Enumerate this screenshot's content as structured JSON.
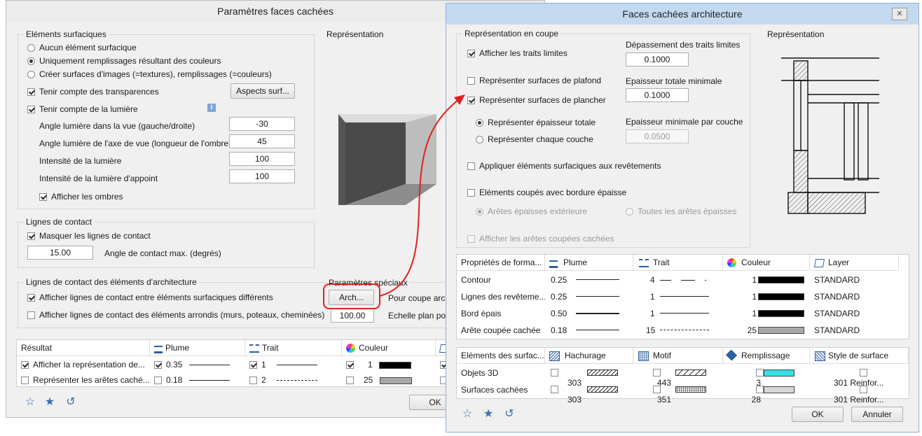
{
  "left": {
    "title": "Paramètres faces cachées",
    "surf_group": "Eléments surfaciques",
    "radio1": "Aucun élément surfacique",
    "radio2": "Uniquement remplissages résultant des couleurs",
    "radio3": "Créer surfaces d'images (=textures), remplissages (=couleurs)",
    "chk_transp": "Tenir compte des transparences",
    "aspects_btn": "Aspects surf...",
    "chk_light": "Tenir compte de la lumière",
    "info_icon": "i",
    "angle_view_label": "Angle lumière dans la vue (gauche/droite)",
    "angle_view_value": "-30",
    "angle_axis_label": "Angle lumière de l'axe de vue (longueur de l'ombre",
    "angle_axis_value": "45",
    "intensity_label": "Intensité de la lumière",
    "intensity_value": "100",
    "intensity_aux_label": "Intensité de la lumière d'appoint",
    "intensity_aux_value": "100",
    "chk_shadows": "Afficher les ombres",
    "repr_title": "Représentation",
    "contact_group": "Lignes de contact",
    "chk_hide_contact": "Masquer les lignes de contact",
    "contact_angle_value": "15.00",
    "contact_angle_label": "Angle de contact max. (degrés)",
    "arch_group": "Lignes de contact des éléments d'architecture",
    "chk_arch1": "Afficher lignes de contact entre éléments surfaciques différents",
    "chk_arch2": "Afficher lignes de contact des éléments arrondis (murs, poteaux, cheminées)",
    "special_title": "Paramètres spéciaux",
    "arch_btn": "Arch...",
    "pour_coupe": "Pour coupe arch",
    "echelle_label": "Echelle plan pou",
    "echelle_value": "100.00",
    "table": {
      "headers": [
        "Résultat",
        "Plume",
        "Trait",
        "Couleur"
      ],
      "rows": [
        {
          "label": "Afficher la représentation de...",
          "checked": true,
          "pen": "0.35",
          "trait": "1",
          "color_num": "1",
          "color": "#000000"
        },
        {
          "label": "Représenter les arêtes caché...",
          "checked": false,
          "pen": "0.18",
          "trait": "2",
          "color_num": "25",
          "color": "#a8a8a8"
        }
      ]
    },
    "ok": "OK"
  },
  "right": {
    "title": "Faces cachées architecture",
    "close": "✕",
    "coupe_group": "Représentation en coupe",
    "chk_traits": "Afficher les traits limites",
    "depassement_label": "Dépassement des traits limites",
    "depassement_value": "0.1000",
    "chk_plafond": "Représenter surfaces de plafond",
    "epaisseur_totale_label": "Epaisseur totale minimale",
    "epaisseur_totale_value": "0.1000",
    "chk_plancher": "Représenter surfaces de plancher",
    "radio_total": "Représenter épaisseur totale",
    "radio_couche": "Représenter chaque couche",
    "epaisseur_couche_label": "Epaisseur minimale par couche",
    "epaisseur_couche_value": "0.0500",
    "chk_appliquer": "Appliquer éléments surfaciques aux revêtements",
    "chk_bordure": "Eléments coupés avec bordure épaisse",
    "radio_ext": "Arêtes épaisses extérieure",
    "radio_toutes": "Toutes les arêtes épaisses",
    "chk_aretes_cachees": "Afficher les arêtes coupées cachées",
    "repr_title": "Représentation",
    "table1": {
      "headers": [
        "Propriétés de forma...",
        "Plume",
        "Trait",
        "Couleur",
        "Layer"
      ],
      "rows": [
        {
          "label": "Contour",
          "pen": "0.25",
          "trait": "4",
          "color_num": "1",
          "color": "#000000",
          "layer": "STANDARD"
        },
        {
          "label": "Lignes des revêteme...",
          "pen": "0.25",
          "trait": "1",
          "color_num": "1",
          "color": "#000000",
          "layer": "STANDARD"
        },
        {
          "label": "Bord épais",
          "pen": "0.50",
          "trait": "1",
          "color_num": "1",
          "color": "#000000",
          "layer": "STANDARD"
        },
        {
          "label": "Arête coupée cachée",
          "pen": "0.18",
          "trait": "15",
          "color_num": "25",
          "color": "#a8a8a8",
          "layer": "STANDARD"
        }
      ]
    },
    "table2": {
      "headers": [
        "Eléments des surfac...",
        "Hachurage",
        "Motif",
        "Remplissage",
        "Style de surface"
      ],
      "rows": [
        {
          "label": "Objets 3D",
          "hatch": "303",
          "motif": "443",
          "fill_num": "3",
          "fill_color": "#33e0e8",
          "style": "301 Reinfor..."
        },
        {
          "label": "Surfaces cachées",
          "hatch": "303",
          "motif": "351",
          "fill_num": "28",
          "fill_color": "#d8d8d8",
          "style": "301 Reinfor..."
        }
      ]
    },
    "ok": "OK",
    "cancel": "Annuler"
  },
  "colors": {
    "annotation": "#e02020",
    "dialog_bg": "#f0f0f0",
    "titlebar_right": "#c3d9ef"
  }
}
